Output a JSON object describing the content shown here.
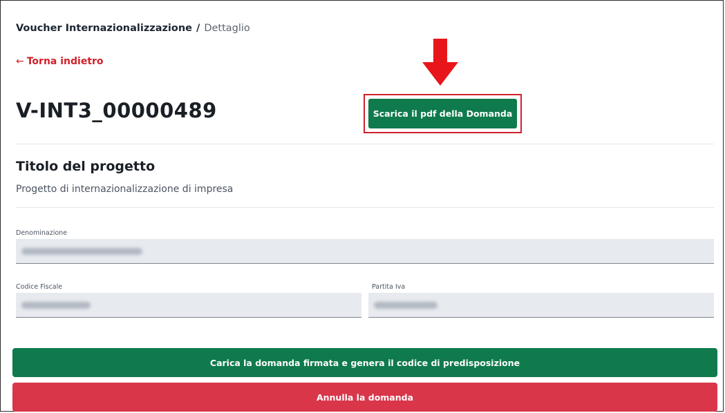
{
  "breadcrumb": {
    "root": "Voucher Internazionalizzazione",
    "separator": "/",
    "current": "Dettaglio"
  },
  "back_link": {
    "arrow": "←",
    "label": "Torna indietro"
  },
  "page_title": "V-INT3_00000489",
  "download_button": {
    "label": "Scarica il pdf della Domanda"
  },
  "project": {
    "heading": "Titolo del progetto",
    "description": "Progetto di internazionalizzazione di impresa"
  },
  "fields": {
    "denominazione": {
      "label": "Denominazione",
      "value": ""
    },
    "codice_fiscale": {
      "label": "Codice Fiscale",
      "value": ""
    },
    "partita_iva": {
      "label": "Partita Iva",
      "value": ""
    }
  },
  "actions": {
    "upload_label": "Carica la domanda firmata e genera il codice di predisposizione",
    "cancel_label": "Annulla la domanda"
  },
  "colors": {
    "primary_green": "#0f7a4c",
    "danger_red": "#d9364a",
    "link_red": "#d1202a",
    "annotation_red": "#e8161b"
  },
  "icons": {
    "back": "arrow-left-icon",
    "annotation": "arrow-down-icon"
  }
}
